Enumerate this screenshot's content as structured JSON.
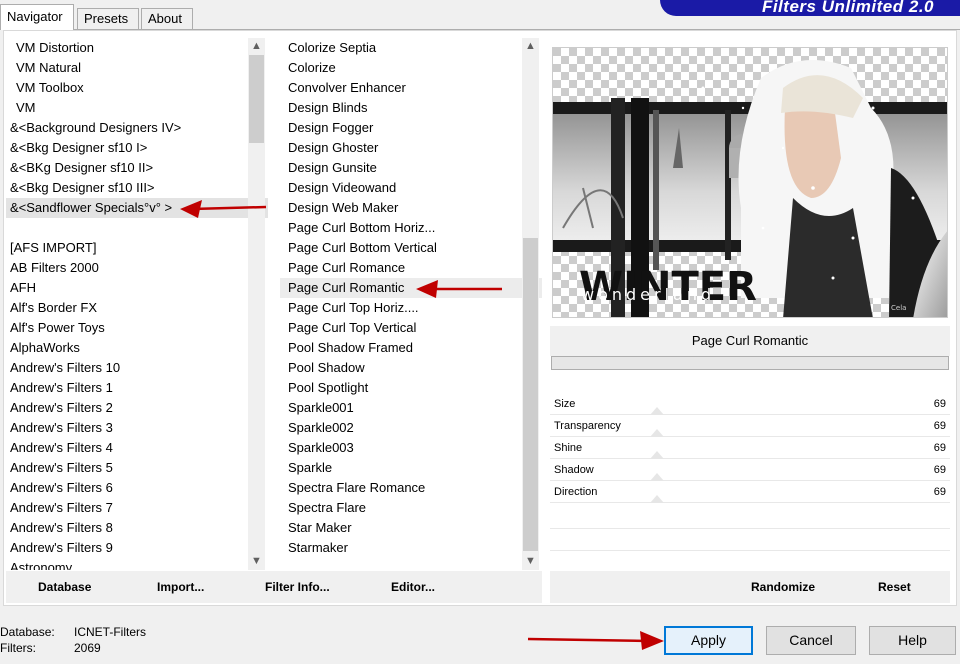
{
  "tabs": [
    {
      "label": "Navigator",
      "active": true
    },
    {
      "label": "Presets",
      "active": false
    },
    {
      "label": "About",
      "active": false
    }
  ],
  "brand_title": "Filters Unlimited 2.0",
  "categories": [
    "VM Distortion",
    "VM Natural",
    "VM Toolbox",
    "VM",
    "&<Background Designers IV>",
    "&<Bkg Designer sf10 I>",
    "&<BKg Designer sf10 II>",
    "&<Bkg Designer sf10 III>",
    "&<Sandflower Specials°v° >",
    "",
    "[AFS IMPORT]",
    "AB Filters 2000",
    "AFH",
    "Alf's Border FX",
    "Alf's Power Toys",
    "AlphaWorks",
    "Andrew's Filters 10",
    "Andrew's Filters 1",
    "Andrew's Filters 2",
    "Andrew's Filters 3",
    "Andrew's Filters 4",
    "Andrew's Filters 5",
    "Andrew's Filters 6",
    "Andrew's Filters 7",
    "Andrew's Filters 8",
    "Andrew's Filters 9",
    "Astronomy"
  ],
  "selected_category_index": 8,
  "filters": [
    "Colorize Septia",
    "Colorize",
    "Convolver Enhancer",
    "Design Blinds",
    "Design Fogger",
    "Design Ghoster",
    "Design Gunsite",
    "Design Videowand",
    "Design Web Maker",
    "Page Curl Bottom Horiz...",
    "Page Curl Bottom Vertical",
    "Page Curl Romance",
    "Page Curl Romantic",
    "Page Curl Top Horiz....",
    "Page Curl Top Vertical",
    "Pool Shadow Framed",
    "Pool Shadow",
    "Pool Spotlight",
    "Sparkle001",
    "Sparkle002",
    "Sparkle003",
    "Sparkle",
    "Spectra Flare Romance",
    "Spectra Flare",
    "Star Maker",
    "Starmaker"
  ],
  "selected_filter_index": 12,
  "preview": {
    "headline": "WINTER",
    "tagline": "wonderland",
    "signature": "Cela"
  },
  "filter_name": "Page Curl Romantic",
  "params": [
    {
      "label": "Size",
      "value": "69"
    },
    {
      "label": "Transparency",
      "value": "69"
    },
    {
      "label": "Shine",
      "value": "69"
    },
    {
      "label": "Shadow",
      "value": "69"
    },
    {
      "label": "Direction",
      "value": "69"
    }
  ],
  "left_buttons": {
    "database": "Database",
    "import": "Import...",
    "filter_info": "Filter Info...",
    "editor": "Editor..."
  },
  "right_buttons": {
    "randomize": "Randomize",
    "reset": "Reset"
  },
  "status": {
    "database_label": "Database:",
    "database_value": "ICNET-Filters",
    "filters_label": "Filters:",
    "filters_value": "2069"
  },
  "dialog_buttons": {
    "apply": "Apply",
    "cancel": "Cancel",
    "help": "Help"
  },
  "colors": {
    "brand": "#1a1aa6",
    "arrow": "#c00000",
    "default_button": "#0078d7"
  }
}
